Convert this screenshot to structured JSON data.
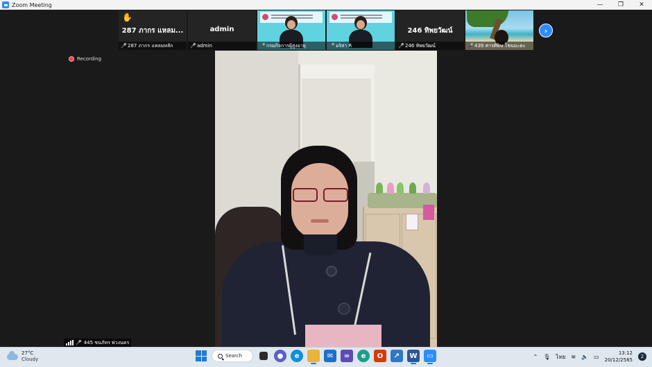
{
  "window": {
    "title": "Zoom Meeting",
    "minimize": "—",
    "restore": "❐",
    "close": "✕"
  },
  "thumbnails": [
    {
      "big_name": "287 ภากร แหลม...",
      "label": "287 ภากร แหลมหลัก",
      "raised_hand": "✋"
    },
    {
      "big_name": "admin",
      "label": "admin"
    },
    {
      "label": "กรมกิจการผู้สูงอายุ"
    },
    {
      "label": "อริสา R"
    },
    {
      "big_name": "246 ทิพยวัฒน์",
      "label": "246 ทิพยวัฒน์"
    },
    {
      "label": "439 ศารศิษิษ  โชนมะตะ"
    }
  ],
  "next_page_icon": "›",
  "recording_label": "Recording",
  "active_speaker_label": "445 ชนภัทร พ่วงนคร",
  "taskbar": {
    "weather_temp": "27°C",
    "weather_condition": "Cloudy",
    "search_label": "Search",
    "language": "ไทย",
    "time": "13:12",
    "date": "20/12/2565",
    "notification_count": "2",
    "apps": [
      {
        "name": "file-explorer",
        "color": "#f2c14e"
      },
      {
        "name": "teams",
        "color": "#5b5fc7"
      },
      {
        "name": "edge",
        "color": "#0f8fd8"
      },
      {
        "name": "folder",
        "color": "#e9b43c"
      },
      {
        "name": "mail",
        "color": "#1f6fc8"
      },
      {
        "name": "vs",
        "color": "#5c4bb5"
      },
      {
        "name": "edge-2",
        "color": "#1a9e8a"
      },
      {
        "name": "office",
        "color": "#d83b01"
      },
      {
        "name": "app",
        "color": "#2f78c4"
      },
      {
        "name": "word",
        "color": "#2b579a"
      },
      {
        "name": "zoom",
        "color": "#2d8cff"
      }
    ]
  }
}
